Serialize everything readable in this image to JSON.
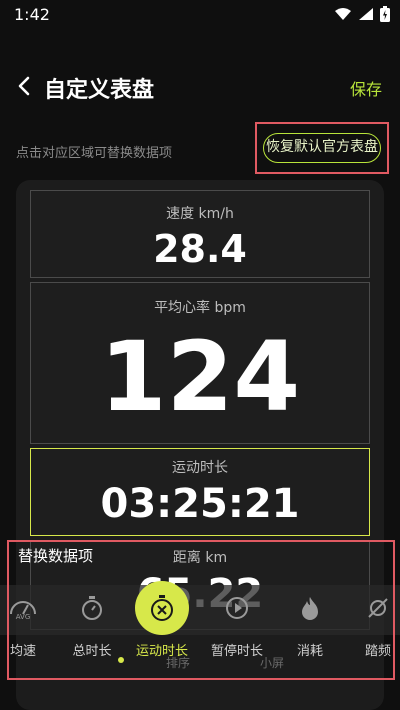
{
  "status": {
    "time": "1:42"
  },
  "header": {
    "title": "自定义表盘",
    "save_label": "保存"
  },
  "hint": "点击对应区域可替换数据项",
  "restore_label": "恢复默认官方表盘",
  "cells": [
    {
      "label": "速度 km/h",
      "value": "28.4"
    },
    {
      "label": "平均心率 bpm",
      "value": "124"
    },
    {
      "label": "运动时长",
      "value": "03:25:21"
    },
    {
      "label": "距离 km",
      "value": "65.22"
    }
  ],
  "panel": {
    "title": "替换数据项",
    "items": [
      {
        "label": "均速",
        "icon": "avg-speed-icon"
      },
      {
        "label": "总时长",
        "icon": "stopwatch-icon"
      },
      {
        "label": "运动时长",
        "icon": "running-stopwatch-icon",
        "selected": true
      },
      {
        "label": "暂停时长",
        "icon": "pause-play-icon"
      },
      {
        "label": "消耗",
        "icon": "flame-icon"
      },
      {
        "label": "踏频",
        "icon": "cadence-icon"
      }
    ]
  },
  "bottom_actions": {
    "sort": "排序",
    "small_screen": "小屏"
  },
  "colors": {
    "accent": "#d7e84a",
    "highlight": "#e05a62",
    "background": "#0f0f0f"
  }
}
